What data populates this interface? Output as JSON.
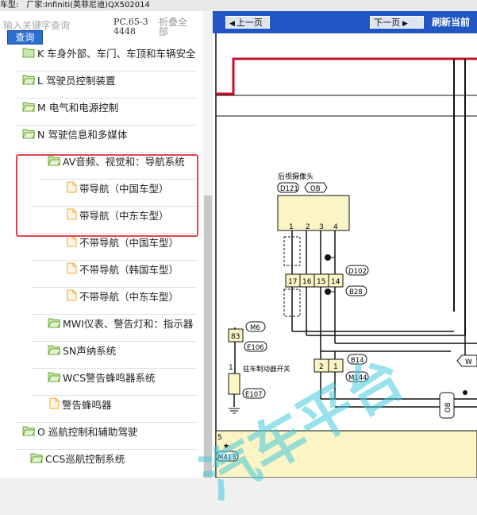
{
  "title_bar": {
    "model_label": "车型:",
    "manufacturer": "厂家:Infiniti(英菲尼迪)QX502014"
  },
  "search": {
    "placeholder": "输入关键字查询",
    "button": "查询"
  },
  "doc_code": "PC.65-34448",
  "collapse_all": "折叠全部",
  "tree": [
    {
      "label": "K 车身外部、车门、车顶和车辆安全"
    },
    {
      "label": "L 驾驶员控制装置"
    },
    {
      "label": "M 电气和电源控制"
    },
    {
      "label": "N 驾驶信息和多媒体"
    },
    {
      "label": "AV音频、视觉和：导航系统"
    },
    {
      "label": "带导航（中国车型）"
    },
    {
      "label": "带导航（中东车型）"
    },
    {
      "label": "不带导航（中国车型）"
    },
    {
      "label": "不带导航（韩国车型）"
    },
    {
      "label": "不带导航（中东车型）"
    },
    {
      "label": "MWI仪表、警告灯和：指示器"
    },
    {
      "label": "SN声纳系统"
    },
    {
      "label": "WCS警告蜂鸣器系统"
    },
    {
      "label": "警告蜂鸣器"
    },
    {
      "label": "O 巡航控制和辅助驾驶"
    },
    {
      "label": "CCS巡航控制系统"
    }
  ],
  "toolbar": {
    "prev": "上一页",
    "next": "下一页",
    "refresh": "刷新当前"
  },
  "diagram": {
    "camera_title": "后视摄像头",
    "camera_conn": "D121",
    "camera_tag": "OB",
    "pins_top": [
      "1",
      "2",
      "3",
      "4"
    ],
    "pins_mid": [
      "17",
      "16",
      "15",
      "14"
    ],
    "conn_d102": "D102",
    "conn_b28": "B28",
    "pin_83": "83",
    "conn_m6": "M6",
    "conn_e106": "E106",
    "pins_b14": [
      "2",
      "1"
    ],
    "conn_b14": "B14",
    "conn_m144": "M144",
    "switch_pin": "1",
    "switch_label": "驻车制动器开关",
    "conn_e107": "E107",
    "ob_tag": "OB",
    "w_tag": "W",
    "bottom_pin": "5",
    "conn_m413": "M413"
  },
  "watermark": "汽车平台",
  "colors": {
    "toolbar": "#2255c4",
    "highlight": "#e04450",
    "folder": "#7cc24a",
    "doc": "#f5b84a",
    "wire_red": "#c8102e",
    "box_yellow": "#fbf4c4"
  }
}
